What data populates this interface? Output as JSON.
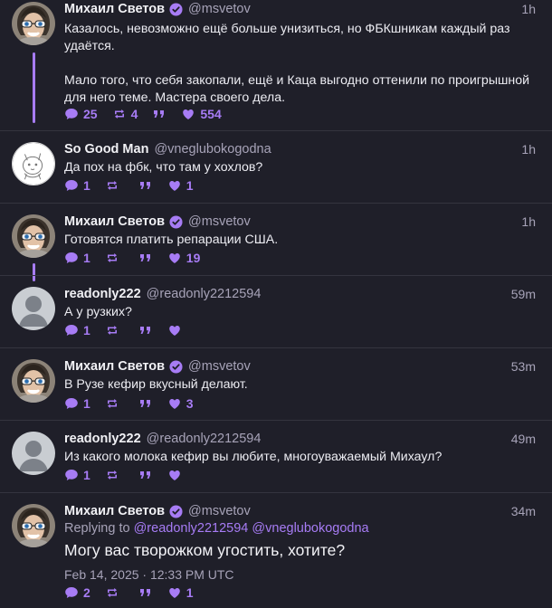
{
  "tweets": [
    {
      "name": "Михаил Светов",
      "handle": "@msvetov",
      "time": "1h",
      "p1": "Казалось, невозможно ещё больше унизиться, но ФБКшникам каждый раз удаётся.",
      "p2": "Мало того, что себя закопали, ещё и Каца выгодно оттенили по проигрышной для него теме. Мастера своего дела.",
      "replies": "25",
      "reposts": "4",
      "likes": "554"
    },
    {
      "name": "So Good Man",
      "handle": "@vneglubokogodna",
      "time": "1h",
      "p1": "Да пох на фбк, что там у хохлов?",
      "replies": "1",
      "reposts": "",
      "likes": "1"
    },
    {
      "name": "Михаил Светов",
      "handle": "@msvetov",
      "time": "1h",
      "p1": "Готовятся платить репарации США.",
      "replies": "1",
      "reposts": "",
      "likes": "19"
    },
    {
      "name": "readonly222",
      "handle": "@readonly2212594",
      "time": "59m",
      "p1": "А у рузких?",
      "replies": "1",
      "reposts": "",
      "likes": ""
    },
    {
      "name": "Михаил Светов",
      "handle": "@msvetov",
      "time": "53m",
      "p1": "В Рузе кефир вкусный делают.",
      "replies": "1",
      "reposts": "",
      "likes": "3"
    },
    {
      "name": "readonly222",
      "handle": "@readonly2212594",
      "time": "49m",
      "p1": "Из какого молока кефир вы любите, многоуважаемый Михаул?",
      "replies": "1",
      "reposts": "",
      "likes": ""
    },
    {
      "name": "Михаил Светов",
      "handle": "@msvetov",
      "time": "34m",
      "replying_prefix": "Replying to",
      "mention1": "@readonly2212594",
      "mention2": "@vneglubokogodna",
      "p1": "Могу вас творожком угостить, хотите?",
      "date": "Feb 14, 2025 · 12:33 PM UTC",
      "replies": "2",
      "reposts": "",
      "likes": "1"
    }
  ],
  "colors": {
    "accent": "#a77cf5",
    "background": "#1f1f29",
    "muted": "#a7a3b8"
  },
  "icons": [
    "reply-icon",
    "repost-icon",
    "quote-icon",
    "heart-icon",
    "verified-icon"
  ]
}
